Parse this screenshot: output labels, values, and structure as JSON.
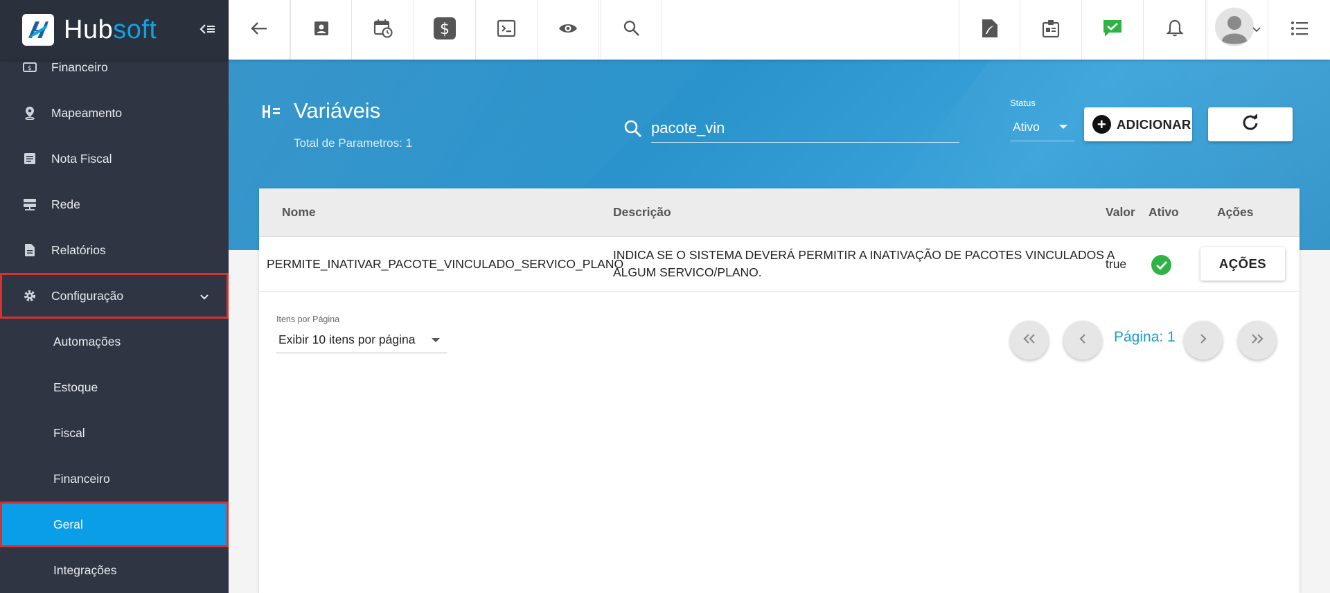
{
  "brand": {
    "name_part1": "Hub",
    "name_part2": "soft"
  },
  "sidebar": {
    "items": [
      {
        "label": "Financeiro"
      },
      {
        "label": "Mapeamento"
      },
      {
        "label": "Nota Fiscal"
      },
      {
        "label": "Rede"
      },
      {
        "label": "Relatórios"
      },
      {
        "label": "Configuração"
      }
    ],
    "subitems": [
      {
        "label": "Automações"
      },
      {
        "label": "Estoque"
      },
      {
        "label": "Fiscal"
      },
      {
        "label": "Financeiro"
      },
      {
        "label": "Geral"
      },
      {
        "label": "Integrações"
      }
    ]
  },
  "page": {
    "title": "Variáveis",
    "subtitle": "Total de Parametros: 1"
  },
  "search": {
    "value": "pacote_vin"
  },
  "status": {
    "label": "Status",
    "value": "Ativo"
  },
  "buttons": {
    "add": "ADICIONAR"
  },
  "table": {
    "headers": {
      "nome": "Nome",
      "descricao": "Descrição",
      "valor": "Valor",
      "ativo": "Ativo",
      "acoes": "Ações"
    },
    "rows": [
      {
        "nome": "PERMITE_INATIVAR_PACOTE_VINCULADO_SERVICO_PLANO",
        "descricao_line1": "INDICA SE O SISTEMA DEVERÁ PERMITIR A INATIVAÇÃO DE PACOTES VINCULADOS A",
        "descricao_line2": "ALGUM SERVICO/PLANO.",
        "valor": "true",
        "ativo": true,
        "acoes": "AÇÕES"
      }
    ]
  },
  "pagination": {
    "items_label": "Itens por Página",
    "items_value": "Exibir 10 itens por página",
    "page_label": "Página: 1"
  },
  "colors": {
    "accent": "#0fa3e6",
    "sidebar": "#2f3542",
    "hero": "#2a93cc",
    "success": "#2fb344",
    "chat": "#2fb344",
    "highlight_border": "#d93131"
  }
}
